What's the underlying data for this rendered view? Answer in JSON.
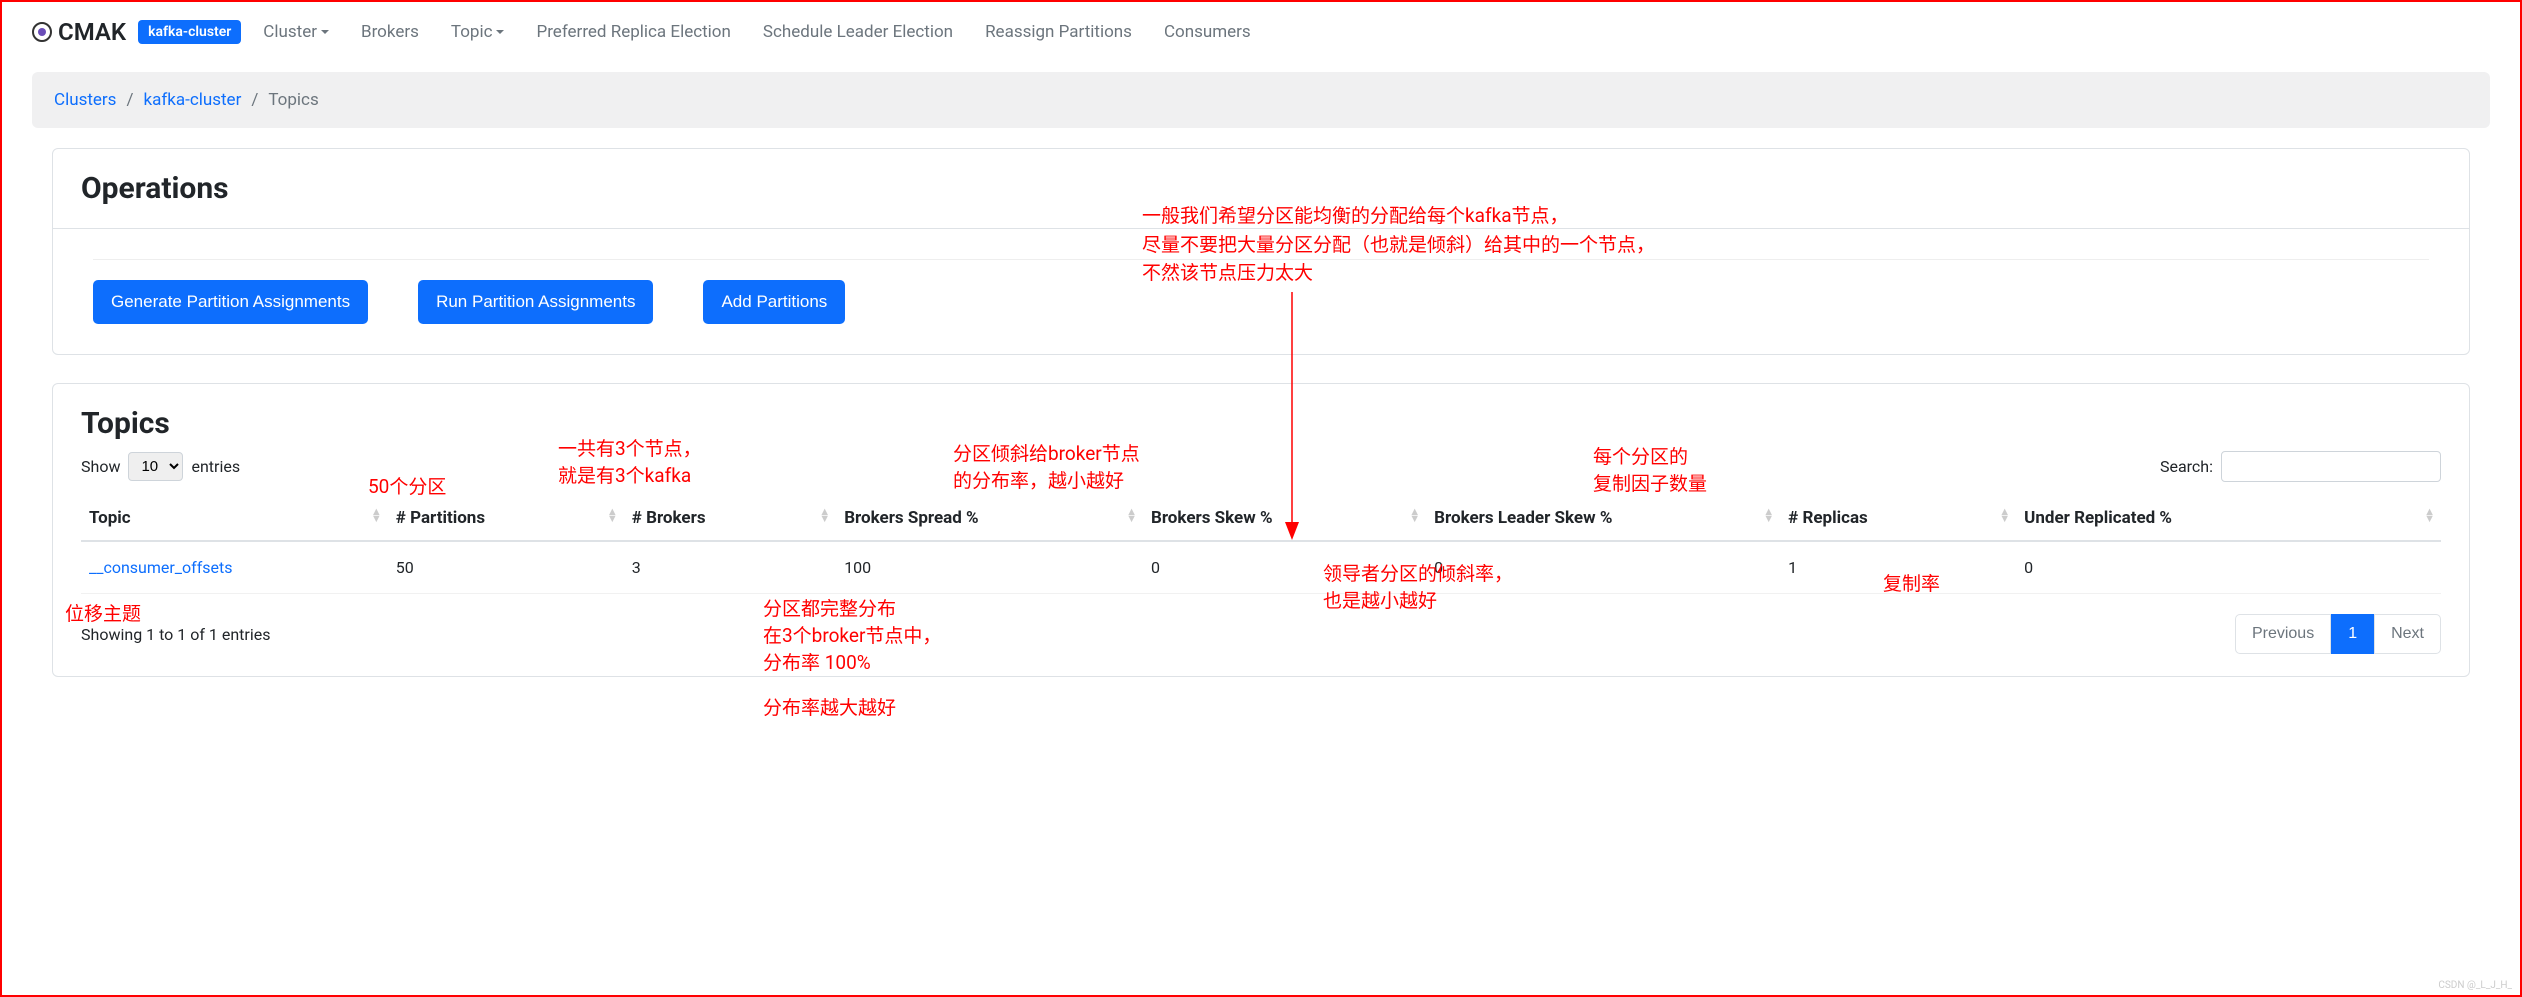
{
  "brand": "CMAK",
  "cluster_badge": "kafka-cluster",
  "nav": {
    "cluster": "Cluster",
    "brokers": "Brokers",
    "topic": "Topic",
    "preferred": "Preferred Replica Election",
    "schedule": "Schedule Leader Election",
    "reassign": "Reassign Partitions",
    "consumers": "Consumers"
  },
  "breadcrumb": {
    "clusters": "Clusters",
    "cluster": "kafka-cluster",
    "topics": "Topics"
  },
  "operations": {
    "title": "Operations",
    "generate": "Generate Partition Assignments",
    "run": "Run Partition Assignments",
    "add": "Add Partitions"
  },
  "topics": {
    "title": "Topics",
    "show": "Show",
    "entries": "entries",
    "entries_select": "10",
    "search_label": "Search:",
    "headers": {
      "topic": "Topic",
      "partitions": "# Partitions",
      "brokers": "# Brokers",
      "spread": "Brokers Spread %",
      "skew": "Brokers Skew %",
      "leader_skew": "Brokers Leader Skew %",
      "replicas": "# Replicas",
      "under": "Under Replicated %"
    },
    "row": {
      "name": "__consumer_offsets",
      "partitions": "50",
      "brokers": "3",
      "spread": "100",
      "skew": "0",
      "leader_skew": "0",
      "replicas": "1",
      "under": "0"
    },
    "info": "Showing 1 to 1 of 1 entries",
    "prev": "Previous",
    "page1": "1",
    "next": "Next"
  },
  "annotations": {
    "top1": "一般我们希望分区能均衡的分配给每个kafka节点，",
    "top2": "尽量不要把大量分区分配（也就是倾斜）给其中的一个节点，",
    "top3": "不然该节点压力太大",
    "partitions": "50个分区",
    "brokers1": "一共有3个节点，",
    "brokers2": "就是有3个kafka",
    "skew1": "分区倾斜给broker节点",
    "skew2": "的分布率，越小越好",
    "replicas1": "每个分区的",
    "replicas2": "复制因子数量",
    "offset": "位移主题",
    "spread1": "分区都完整分布",
    "spread2": "在3个broker节点中，",
    "spread3": "分布率 100%",
    "spread4": "分布率越大越好",
    "leader1": "领导者分区的倾斜率，",
    "leader2": "也是越小越好",
    "under": "复制率"
  },
  "watermark": "CSDN @_L_J_H_"
}
